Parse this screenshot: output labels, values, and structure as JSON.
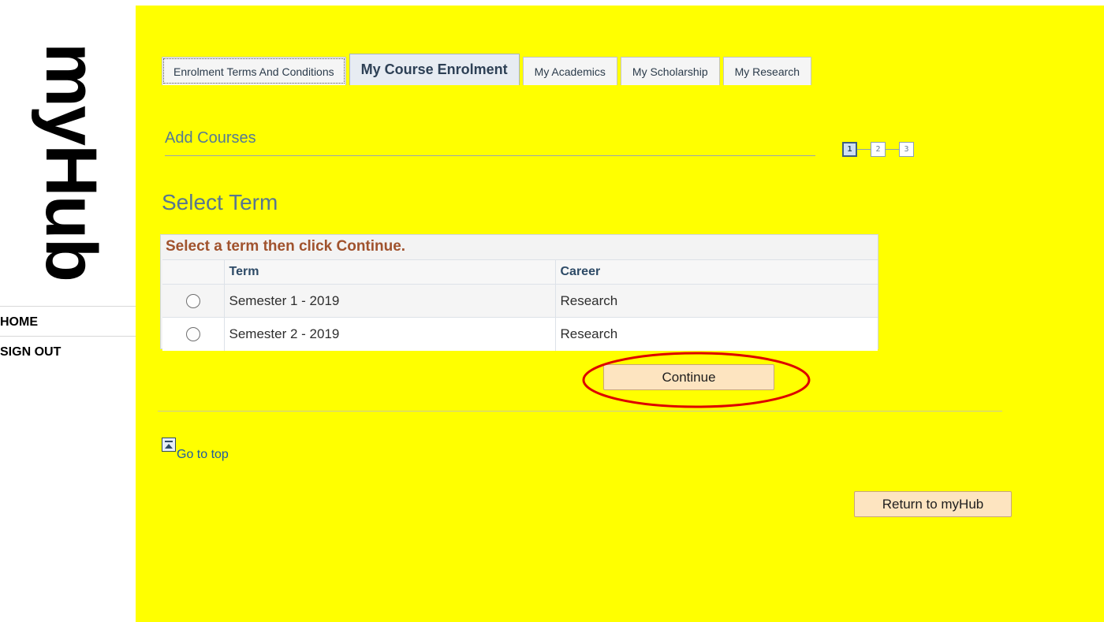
{
  "sidebar": {
    "logo": "myHub",
    "links": [
      {
        "label": "HOME"
      },
      {
        "label": "SIGN OUT"
      }
    ]
  },
  "tabs": [
    {
      "label": "Enrolment Terms And Conditions",
      "active": false
    },
    {
      "label": "My Course Enrolment",
      "active": true
    },
    {
      "label": "My Academics",
      "active": false
    },
    {
      "label": "My Scholarship",
      "active": false
    },
    {
      "label": "My Research",
      "active": false
    }
  ],
  "section": {
    "title": "Add Courses",
    "steps": [
      "1",
      "2",
      "3"
    ],
    "current_step": "1"
  },
  "page_title": "Select Term",
  "term_table": {
    "instruction": "Select a term then click Continue.",
    "columns": [
      "Term",
      "Career"
    ],
    "rows": [
      {
        "term": "Semester 1 - 2019",
        "career": "Research"
      },
      {
        "term": "Semester 2 - 2019",
        "career": "Research"
      }
    ]
  },
  "buttons": {
    "continue": "Continue",
    "return": "Return to myHub"
  },
  "go_top": "Go to top",
  "colors": {
    "main_background": "#ffff00",
    "highlight_ellipse": "#dd0000",
    "button_fill": "#fde4c0",
    "instruction_text": "#a0522d"
  }
}
